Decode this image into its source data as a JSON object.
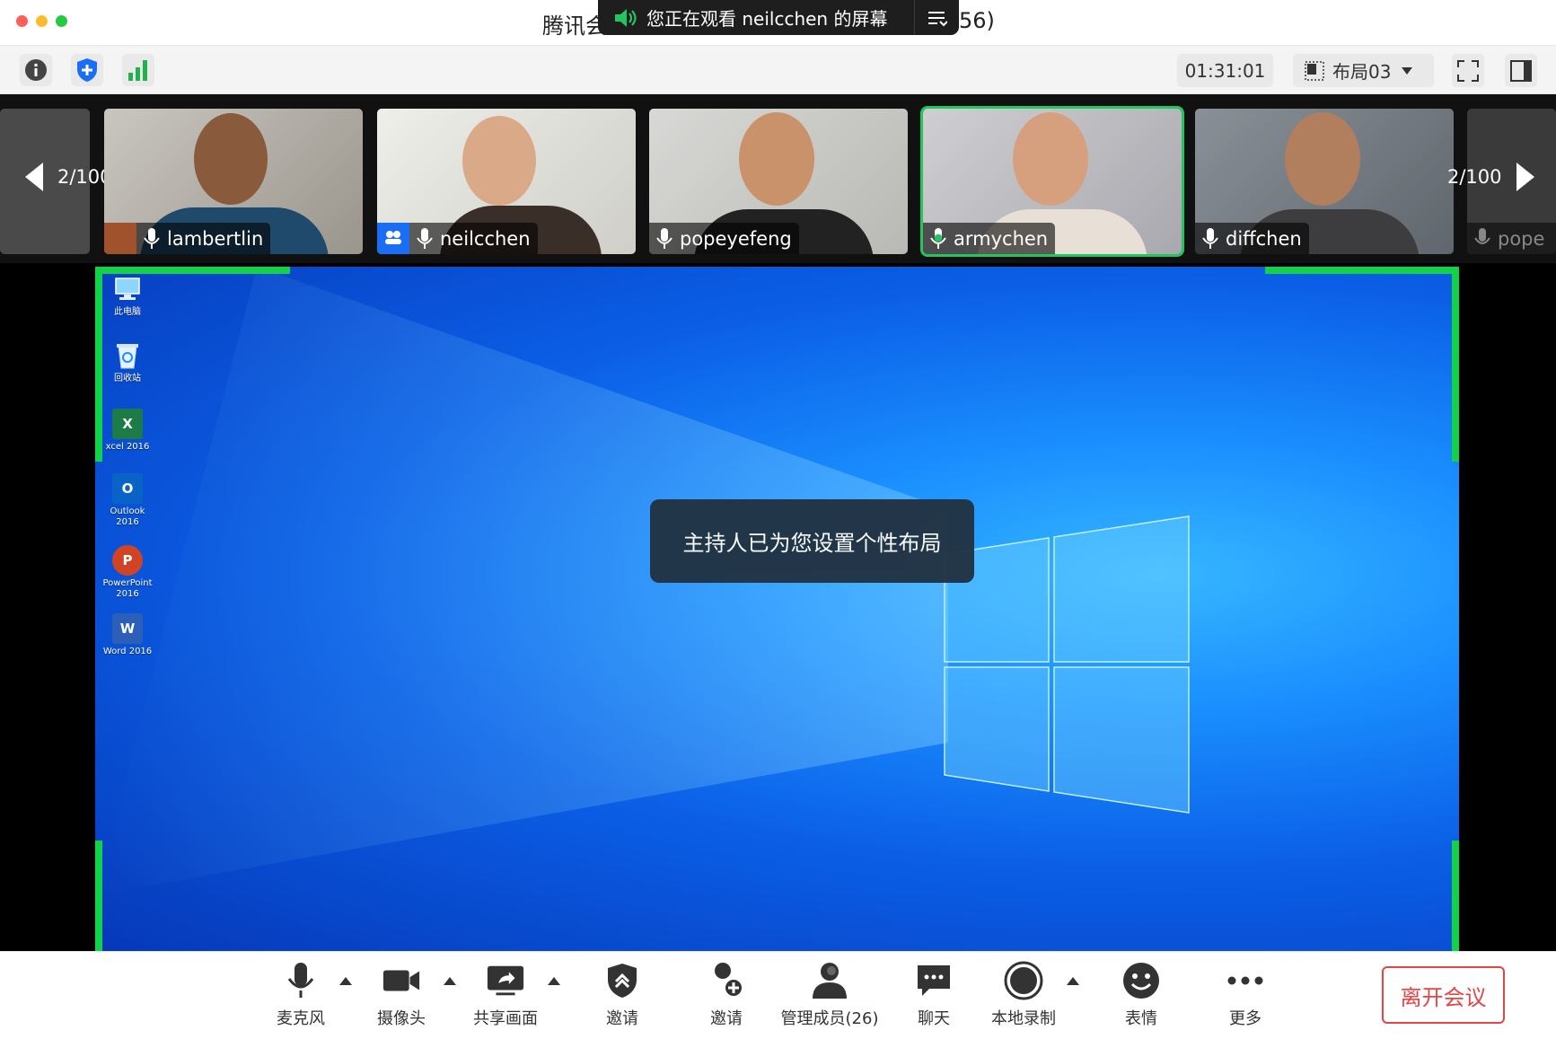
{
  "window": {
    "title_prefix": "腾讯会",
    "title_suffix": "56)",
    "viewing_banner": "您正在观看 neilcchen 的屏幕"
  },
  "toolbar": {
    "timer": "01:31:01",
    "layout_label": "布局03"
  },
  "gallery": {
    "page_left": "2/100",
    "page_right": "2/100",
    "participants": [
      {
        "name": "lambertlin",
        "active": false
      },
      {
        "name": "neilcchen",
        "active": false
      },
      {
        "name": "popeyefeng",
        "active": false
      },
      {
        "name": "armychen",
        "active": true
      },
      {
        "name": "diffchen",
        "active": false
      }
    ],
    "partial_name": "pope"
  },
  "desktop": {
    "icons": [
      {
        "label": "此电脑",
        "icon": "computer-icon"
      },
      {
        "label": "回收站",
        "icon": "recycle-bin-icon"
      },
      {
        "label": "xcel 2016",
        "icon": "excel-icon",
        "letter": "X"
      },
      {
        "label": "Outlook 2016",
        "icon": "outlook-icon",
        "letter": "O"
      },
      {
        "label": "PowerPoint 2016",
        "icon": "powerpoint-icon",
        "letter": "P"
      },
      {
        "label": "Word 2016",
        "icon": "word-icon",
        "letter": "W"
      }
    ],
    "toast": "主持人已为您设置个性布局"
  },
  "controls": {
    "mic": "麦克风",
    "camera": "摄像头",
    "share": "共享画面",
    "security": "邀请",
    "invite": "邀请",
    "members": "管理成员(26)",
    "chat": "聊天",
    "record": "本地录制",
    "reactions": "表情",
    "more": "更多",
    "leave": "离开会议"
  },
  "colors": {
    "active_green": "#22c55e",
    "leave_red": "#e54545",
    "desktop_blue": "#0b5fe6"
  }
}
